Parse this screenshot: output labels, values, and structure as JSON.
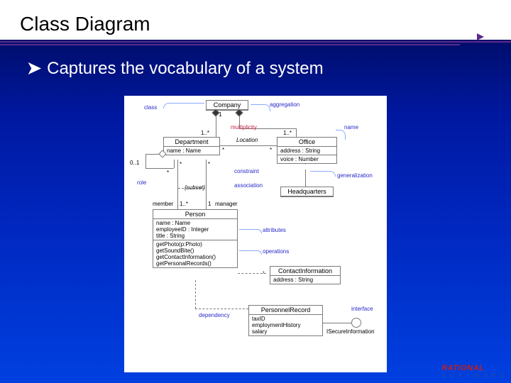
{
  "slide": {
    "title": "Class Diagram",
    "bullet": "Captures the vocabulary of a system"
  },
  "labels": {
    "class": "class",
    "aggregation": "aggregation",
    "name": "name",
    "multiplicity": "multiplicity",
    "constraint": "constraint",
    "association": "association",
    "role": "role",
    "generalization": "generalization",
    "attributes": "attributes",
    "operations": "operations",
    "dependency": "dependency",
    "interface": "interface"
  },
  "classes": {
    "company": "Company",
    "department": {
      "name": "Department",
      "attr": "name : Name"
    },
    "office": {
      "name": "Office",
      "attr1": "address : String",
      "attr2": "voice : Number"
    },
    "headquarters": "Headquarters",
    "person": {
      "name": "Person",
      "attr1": "name : Name",
      "attr2": "employeeID : Integer",
      "attr3": "title : String",
      "op1": "getPhoto(p:Photo)",
      "op2": "getSoundBite()",
      "op3": "getContactInformation()",
      "op4": "getPersonalRecords()"
    },
    "contact": {
      "name": "ContactInformation",
      "attr": "address : String"
    },
    "record": {
      "name": "PersonnelRecord",
      "attr": "taxID\nemploymentHistory\nsalary"
    },
    "isecure": "ISecureInformation"
  },
  "mult": {
    "one": "1",
    "one_star": "1..*",
    "star": "*",
    "zero_one": "0..1",
    "subset": "{subset}",
    "member": "member",
    "manager": "manager",
    "location": "Location"
  },
  "logo": {
    "brand": "RATIONAL",
    "sub": "S O F T W A R E"
  }
}
